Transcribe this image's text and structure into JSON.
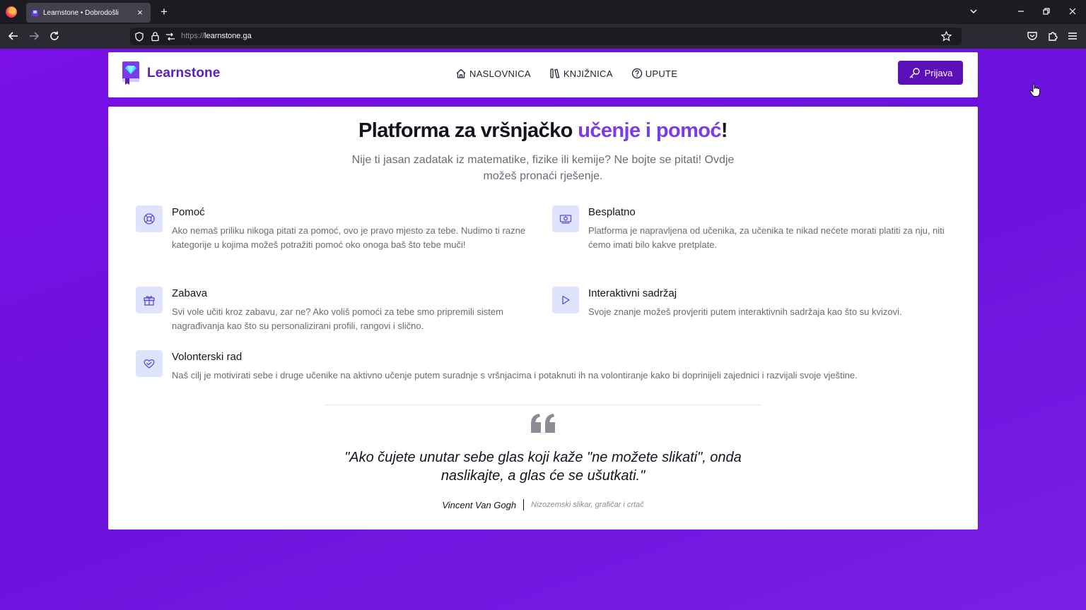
{
  "browser": {
    "tab_title": "Learnstone • Dobrodošli",
    "tab_close": "×",
    "new_tab": "+",
    "url_scheme": "https://",
    "url_host": "learnstone.ga"
  },
  "site": {
    "brand": "Learnstone",
    "nav": [
      {
        "label": "NASLOVNICA",
        "icon": "home-icon"
      },
      {
        "label": "KNJIŽNICA",
        "icon": "library-icon"
      },
      {
        "label": "UPUTE",
        "icon": "help-icon"
      }
    ],
    "login_label": "Prijava",
    "colors": {
      "accent": "#7c3aed",
      "brand": "#5b21b6",
      "button": "#5b0fb8",
      "background": "#6a12dc"
    }
  },
  "hero": {
    "title_start": "Platforma za vršnjačko ",
    "title_accent": "učenje i pomoć",
    "title_end": "!",
    "subtitle": "Nije ti jasan zadatak iz matematike, fizike ili kemije? Ne bojte se pitati! Ovdje možeš pronaći rješenje."
  },
  "features": [
    {
      "title": "Pomoć",
      "icon": "lifebuoy-icon",
      "desc": "Ako nemaš priliku nikoga pitati za pomoć, ovo je pravo mjesto za tebe. Nudimo ti razne kategorije u kojima možeš potražiti pomoć oko onoga baš što tebe muči!"
    },
    {
      "title": "Besplatno",
      "icon": "money-icon",
      "desc": "Platforma je napravljena od učenika, za učenika te nikad nećete morati platiti za nju, niti ćemo imati bilo kakve pretplate."
    },
    {
      "title": "Zabava",
      "icon": "gift-icon",
      "desc": "Svi vole učiti kroz zabavu, zar ne? Ako voliš pomoći za tebe smo pripremili sistem nagrađivanja kao što su personalizirani profili, rangovi i slično."
    },
    {
      "title": "Interaktivni sadržaj",
      "icon": "play-icon",
      "desc": "Svoje znanje možeš provjeriti putem interaktivnih sadržaja kao što su kvizovi."
    },
    {
      "title": "Volonterski rad",
      "icon": "heart-hand-icon",
      "desc": "Naš cilj je motivirati sebe i druge učenike na aktivno učenje putem suradnje s vršnjacima i potaknuti ih na volontiranje kako bi doprinijeli zajednici i razvijali svoje vještine."
    }
  ],
  "quote": {
    "text": "\"Ako čujete unutar sebe glas koji kaže \"ne možete slikati\", onda naslikajte, a glas će se ušutkati.\"",
    "author": "Vincent Van Gogh",
    "role": "Nizozemski slikar, grafičar i crtač"
  }
}
